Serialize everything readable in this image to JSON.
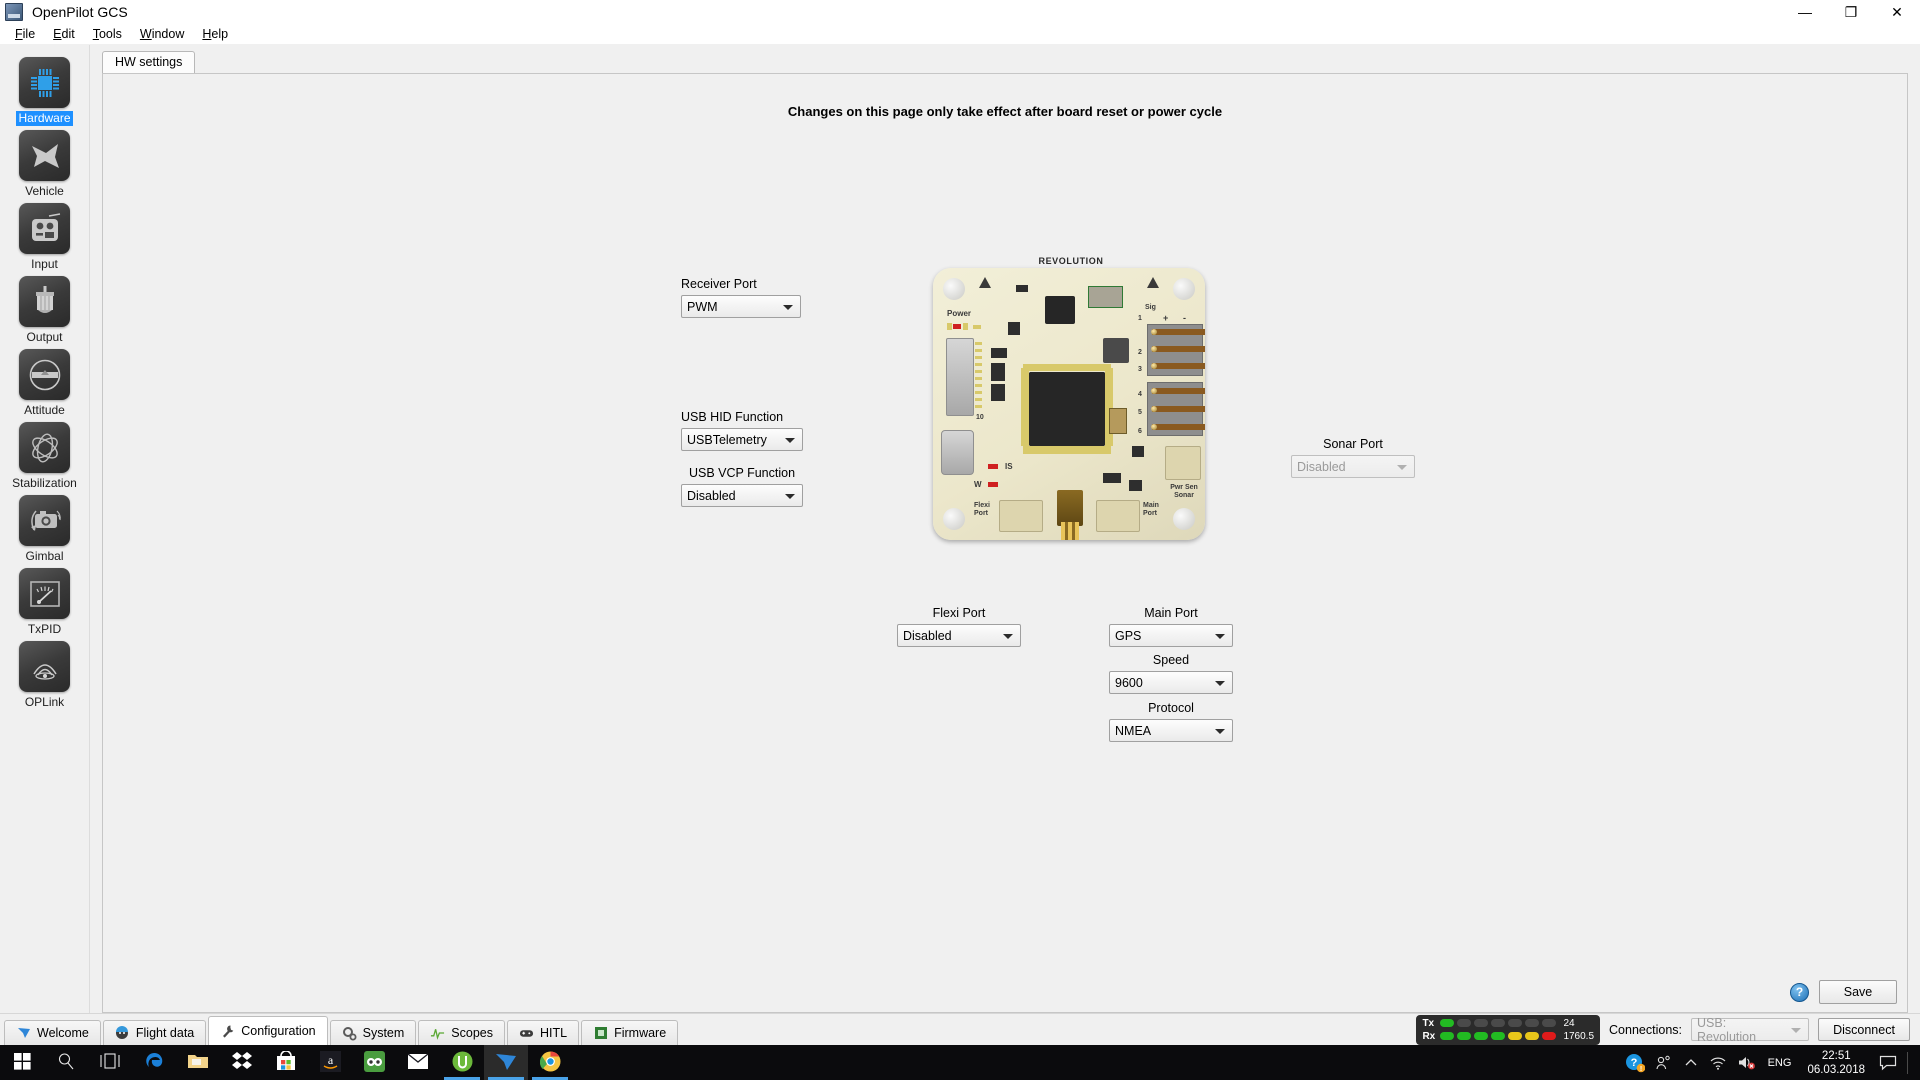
{
  "window": {
    "title": "OpenPilot GCS",
    "app_icon": "openpilot-logo-icon",
    "controls": {
      "minimize": "—",
      "maximize": "❐",
      "close": "✕"
    }
  },
  "menubar": [
    {
      "label": "File",
      "mnemonic": "F"
    },
    {
      "label": "Edit",
      "mnemonic": "E"
    },
    {
      "label": "Tools",
      "mnemonic": "T"
    },
    {
      "label": "Window",
      "mnemonic": "W"
    },
    {
      "label": "Help",
      "mnemonic": "H"
    }
  ],
  "sidebar": {
    "active_index": 0,
    "active_highlight_color": "#1e90ff",
    "items": [
      {
        "label": "Hardware",
        "icon": "cpu-chip-icon"
      },
      {
        "label": "Vehicle",
        "icon": "aircraft-icon"
      },
      {
        "label": "Input",
        "icon": "rc-transmitter-icon"
      },
      {
        "label": "Output",
        "icon": "motor-icon"
      },
      {
        "label": "Attitude",
        "icon": "horizon-level-icon"
      },
      {
        "label": "Stabilization",
        "icon": "gyro-orbit-icon"
      },
      {
        "label": "Gimbal",
        "icon": "camera-rotate-icon"
      },
      {
        "label": "TxPID",
        "icon": "gauge-meter-icon"
      },
      {
        "label": "OPLink",
        "icon": "antenna-signal-icon"
      }
    ]
  },
  "main": {
    "tab": "HW settings",
    "notice": "Changes on this page only take effect after board reset or power cycle",
    "fields": [
      {
        "id": "receiver-port",
        "label": "Receiver Port",
        "value": "PWM",
        "disabled": false,
        "align": "left"
      },
      {
        "id": "usb-hid-function",
        "label": "USB HID Function",
        "value": "USBTelemetry",
        "disabled": false,
        "align": "left"
      },
      {
        "id": "usb-vcp-function",
        "label": "USB VCP Function",
        "value": "Disabled",
        "disabled": false,
        "align": "center"
      },
      {
        "id": "sonar-port",
        "label": "Sonar Port",
        "value": "Disabled",
        "disabled": true,
        "align": "center"
      },
      {
        "id": "flexi-port",
        "label": "Flexi Port",
        "value": "Disabled",
        "disabled": false,
        "align": "center"
      },
      {
        "id": "main-port",
        "label": "Main Port",
        "value": "GPS",
        "disabled": false,
        "align": "center"
      },
      {
        "id": "speed",
        "label": "Speed",
        "value": "9600",
        "disabled": false,
        "align": "center"
      },
      {
        "id": "protocol",
        "label": "Protocol",
        "value": "NMEA",
        "disabled": false,
        "align": "center"
      }
    ],
    "board": {
      "name": "REVOLUTION",
      "labels": {
        "power": "Power",
        "sig": "Sig",
        "plus": "+",
        "minus": "-",
        "pin10": "10",
        "is": "IS",
        "w": "W",
        "flexi_port": "Flexi\nPort",
        "main_port": "Main\nPort",
        "pwr_sen_sonar": "Pwr Sen\nSonar"
      },
      "channel_numbers": [
        "1",
        "2",
        "3",
        "4",
        "5",
        "6"
      ]
    },
    "help_button": "?",
    "save_button": "Save"
  },
  "statusbar": {
    "tabs": [
      {
        "label": "Welcome",
        "icon": "openpilot-bird-icon",
        "active": false
      },
      {
        "label": "Flight data",
        "icon": "flight-data-icon",
        "active": false
      },
      {
        "label": "Configuration",
        "icon": "wrench-icon",
        "active": true
      },
      {
        "label": "System",
        "icon": "gears-icon",
        "active": false
      },
      {
        "label": "Scopes",
        "icon": "waveform-icon",
        "active": false
      },
      {
        "label": "HITL",
        "icon": "gamepad-icon",
        "active": false
      },
      {
        "label": "Firmware",
        "icon": "chip-icon",
        "active": false
      }
    ],
    "telemetry": {
      "tx_label": "Tx",
      "rx_label": "Rx",
      "tx_value": "24",
      "rx_value": "1760.5",
      "tx_leds": [
        "green",
        "off",
        "off",
        "off",
        "off",
        "off",
        "off"
      ],
      "rx_leds": [
        "green",
        "green",
        "green",
        "green",
        "yellow",
        "yellow",
        "red"
      ],
      "colors": {
        "green": "#22bb22",
        "yellow": "#e8c61a",
        "red": "#e01b1b",
        "off": "#4a4a4a"
      }
    },
    "connections_label": "Connections:",
    "connection_value": "USB: Revolution",
    "connection_disabled": true,
    "disconnect_button": "Disconnect"
  },
  "taskbar": {
    "items": [
      {
        "name": "start-button",
        "icon": "windows-logo-icon",
        "state": "none"
      },
      {
        "name": "search-button",
        "icon": "search-icon",
        "state": "none"
      },
      {
        "name": "task-view-button",
        "icon": "task-view-icon",
        "state": "none"
      },
      {
        "name": "edge-button",
        "icon": "edge-icon",
        "state": "none"
      },
      {
        "name": "file-explorer-button",
        "icon": "folder-icon",
        "state": "none"
      },
      {
        "name": "dropbox-button",
        "icon": "dropbox-icon",
        "state": "none"
      },
      {
        "name": "store-button",
        "icon": "microsoft-store-icon",
        "state": "none"
      },
      {
        "name": "amazon-button",
        "icon": "amazon-icon",
        "state": "none"
      },
      {
        "name": "tripadvisor-button",
        "icon": "tripadvisor-icon",
        "state": "none"
      },
      {
        "name": "mail-button",
        "icon": "mail-icon",
        "state": "none"
      },
      {
        "name": "utorrent-button",
        "icon": "utorrent-icon",
        "state": "running"
      },
      {
        "name": "openpilot-button",
        "icon": "openpilot-bird-icon",
        "state": "focused"
      },
      {
        "name": "chrome-button",
        "icon": "chrome-icon",
        "state": "running"
      }
    ],
    "tray": {
      "action_center_icon": "help-circle-icon",
      "people_icon": "people-icon",
      "chevron_icon": "show-hidden-icons-icon",
      "network_icon": "wifi-icon",
      "volume_icon": "volume-muted-icon",
      "language": "ENG",
      "time": "22:51",
      "date": "06.03.2018",
      "notifications_icon": "notifications-icon"
    }
  }
}
